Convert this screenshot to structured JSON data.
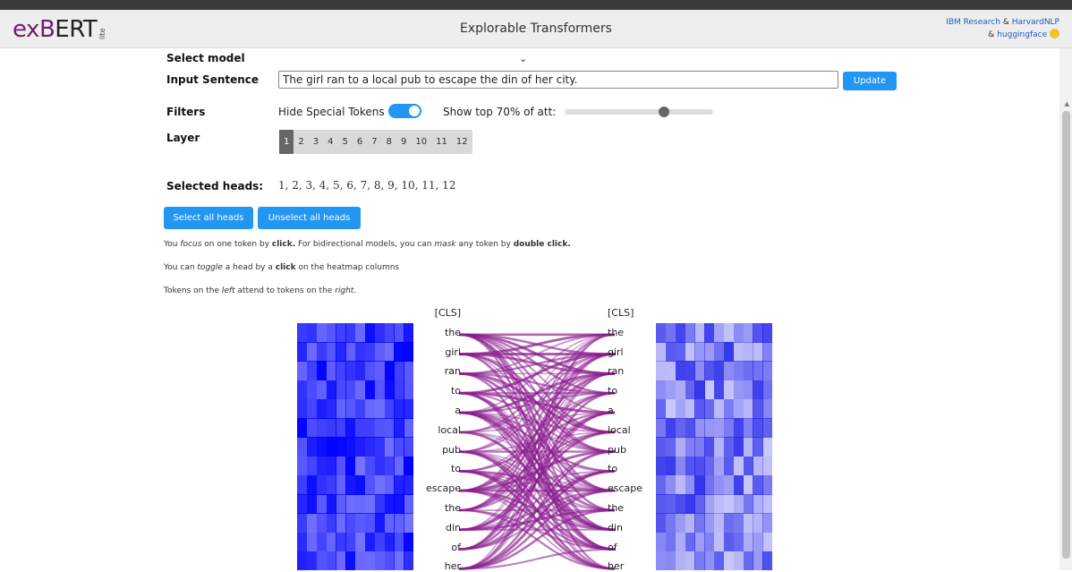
{
  "header": {
    "logo_prefix": "ex",
    "logo_three": "B",
    "logo_suffix": "ERT",
    "logo_lite": "lite",
    "title": "Explorable Transformers",
    "credit_ibm": "IBM Research",
    "credit_amp1": "&",
    "credit_harvard": "HarvardNLP",
    "credit_amp2": "&",
    "credit_hf": "huggingface"
  },
  "controls": {
    "model_label": "Select model",
    "model_value": "",
    "sentence_label": "Input Sentence",
    "sentence_value": "The girl ran to a local pub to escape the din of her city.",
    "update_label": "Update",
    "filters_label": "Filters",
    "hide_special_label": "Hide Special Tokens",
    "hide_special_on": true,
    "show_top_label": "Show top 70% of att:",
    "show_top_percent": 70,
    "layer_label": "Layer",
    "layers": [
      "1",
      "2",
      "3",
      "4",
      "5",
      "6",
      "7",
      "8",
      "9",
      "10",
      "11",
      "12"
    ],
    "active_layer": "1",
    "selected_heads_label": "Selected heads:",
    "selected_heads": "1, 2, 3, 4, 5, 6, 7, 8, 9, 10, 11, 12",
    "select_all_label": "Select all heads",
    "unselect_all_label": "Unselect all heads"
  },
  "info": {
    "line1_a": "You ",
    "line1_focus": "focus",
    "line1_b": " on one token by ",
    "line1_click": "click.",
    "line1_c": " For bidirectional models, you can ",
    "line1_mask": "mask",
    "line1_d": " any token by ",
    "line1_dbl": "double click.",
    "line2_a": "You can ",
    "line2_toggle": "toggle",
    "line2_b": " a head by a ",
    "line2_click": "click",
    "line2_c": " on the heatmap columns",
    "line3_a": "Tokens on the ",
    "line3_left": "left",
    "line3_b": " attend to tokens on the ",
    "line3_right": "right",
    "line3_c": "."
  },
  "tokens": {
    "left": [
      "[CLS]",
      "the",
      "girl",
      "ran",
      "to",
      "a",
      "local",
      "pub",
      "to",
      "escape",
      "the",
      "din",
      "of",
      "her"
    ],
    "right": [
      "[CLS]",
      "the",
      "girl",
      "ran",
      "to",
      "a",
      "local",
      "pub",
      "to",
      "escape",
      "the",
      "din",
      "of",
      "her"
    ]
  },
  "colors": {
    "accent": "#2196f3",
    "edge": "#8b1e8f",
    "heat_left": "#0000ff",
    "heat_right": "#5050ee"
  }
}
